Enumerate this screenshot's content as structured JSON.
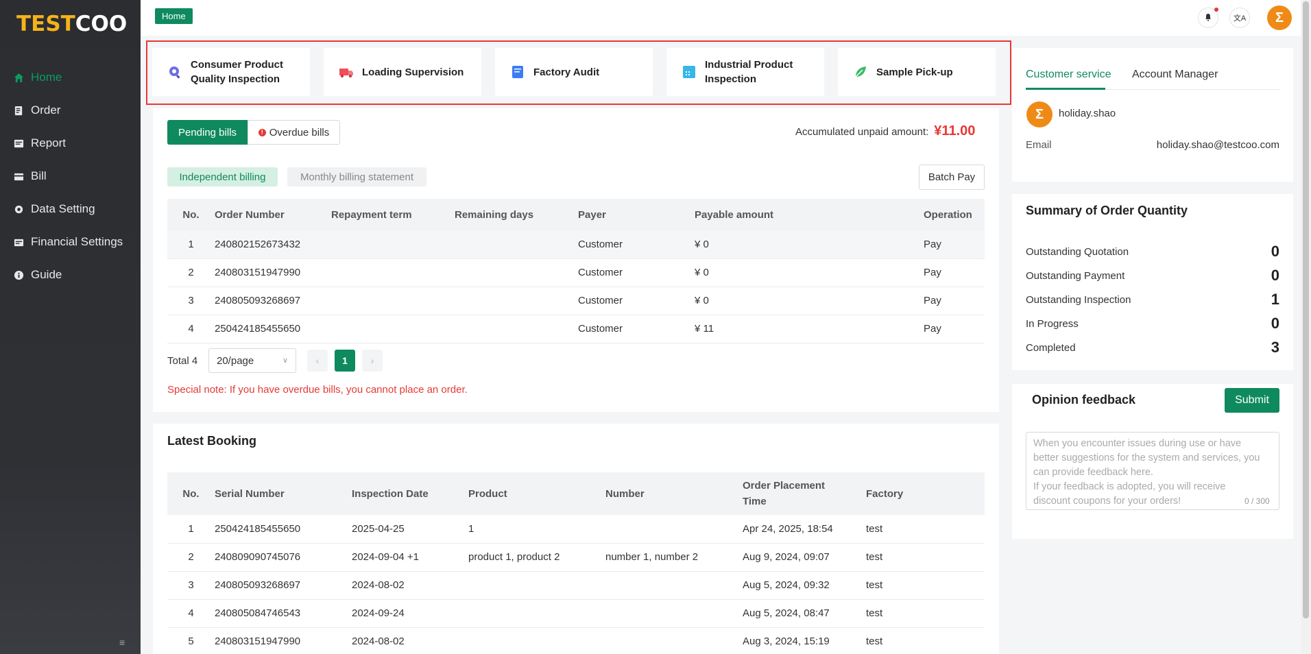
{
  "logo": {
    "part1": "TEST",
    "part2": "COO"
  },
  "sidebar": {
    "items": [
      {
        "label": "Home",
        "icon": "home-icon",
        "active": true
      },
      {
        "label": "Order",
        "icon": "order-icon"
      },
      {
        "label": "Report",
        "icon": "report-icon"
      },
      {
        "label": "Bill",
        "icon": "bill-icon"
      },
      {
        "label": "Data Setting",
        "icon": "gear-icon"
      },
      {
        "label": "Financial Settings",
        "icon": "financial-icon"
      },
      {
        "label": "Guide",
        "icon": "info-icon"
      }
    ],
    "toggle": "≡"
  },
  "header": {
    "breadcrumb": "Home",
    "translate_glyph": "文A"
  },
  "services": [
    {
      "line1": "Consumer Product",
      "line2": "Quality Inspection",
      "icon": "consumer-inspection-icon"
    },
    {
      "line1": "Loading Supervision",
      "line2": "",
      "icon": "truck-icon"
    },
    {
      "line1": "Factory Audit",
      "line2": "",
      "icon": "document-icon"
    },
    {
      "line1": "Industrial Product",
      "line2": "Inspection",
      "icon": "industrial-icon"
    },
    {
      "line1": "Sample Pick-up",
      "line2": "",
      "icon": "leaf-icon"
    }
  ],
  "bills": {
    "pending_label": "Pending bills",
    "overdue_label": "Overdue bills",
    "accum_label": "Accumulated unpaid amount:",
    "accum_value": "¥11.00",
    "independent_label": "Independent billing",
    "monthly_label": "Monthly billing statement",
    "batch_pay_label": "Batch Pay",
    "columns": [
      "No.",
      "Order Number",
      "Repayment term",
      "Remaining days",
      "Payer",
      "Payable amount",
      "Operation"
    ],
    "rows": [
      {
        "no": "1",
        "order": "240802152673432",
        "term": "",
        "days": "",
        "payer": "Customer",
        "amount": "¥ 0",
        "op": "Pay"
      },
      {
        "no": "2",
        "order": "240803151947990",
        "term": "",
        "days": "",
        "payer": "Customer",
        "amount": "¥ 0",
        "op": "Pay"
      },
      {
        "no": "3",
        "order": "240805093268697",
        "term": "",
        "days": "",
        "payer": "Customer",
        "amount": "¥ 0",
        "op": "Pay"
      },
      {
        "no": "4",
        "order": "250424185455650",
        "term": "",
        "days": "",
        "payer": "Customer",
        "amount": "¥ 11",
        "op": "Pay"
      }
    ],
    "total_label": "Total 4",
    "page_size": "20/page",
    "current_page": "1",
    "prev": "‹",
    "next": "›",
    "note": "Special note: If you have overdue bills, you cannot place an order."
  },
  "booking": {
    "title": "Latest Booking",
    "columns": [
      "No.",
      "Serial Number",
      "Inspection Date",
      "Product",
      "Number",
      "Order Placement Time",
      "Factory"
    ],
    "col_order_time_l1": "Order Placement",
    "col_order_time_l2": "Time",
    "rows": [
      {
        "no": "1",
        "serial": "250424185455650",
        "date": "2025-04-25",
        "product": "1",
        "number": "",
        "time": "Apr 24, 2025, 18:54",
        "factory": "test"
      },
      {
        "no": "2",
        "serial": "240809090745076",
        "date": "2024-09-04 +1",
        "product": "product 1, product 2",
        "number": "number 1, number 2",
        "time": "Aug 9, 2024, 09:07",
        "factory": "test"
      },
      {
        "no": "3",
        "serial": "240805093268697",
        "date": "2024-08-02",
        "product": "",
        "number": "",
        "time": "Aug 5, 2024, 09:32",
        "factory": "test"
      },
      {
        "no": "4",
        "serial": "240805084746543",
        "date": "2024-09-24",
        "product": "",
        "number": "",
        "time": "Aug 5, 2024, 08:47",
        "factory": "test"
      },
      {
        "no": "5",
        "serial": "240803151947990",
        "date": "2024-08-02",
        "product": "",
        "number": "",
        "time": "Aug 3, 2024, 15:19",
        "factory": "test"
      }
    ]
  },
  "contact": {
    "tab_customer": "Customer service",
    "tab_manager": "Account Manager",
    "name": "holiday.shao",
    "email_label": "Email",
    "email_value": "holiday.shao@testcoo.com"
  },
  "summary": {
    "title": "Summary of Order Quantity",
    "rows": [
      {
        "label": "Outstanding Quotation",
        "value": "0"
      },
      {
        "label": "Outstanding Payment",
        "value": "0"
      },
      {
        "label": "Outstanding Inspection",
        "value": "1"
      },
      {
        "label": "In Progress",
        "value": "0"
      },
      {
        "label": "Completed",
        "value": "3"
      }
    ]
  },
  "feedback": {
    "title": "Opinion feedback",
    "submit_label": "Submit",
    "placeholder_l1": "When you encounter issues during use or have",
    "placeholder_l2": "better suggestions for the system and services, you",
    "placeholder_l3": "can provide feedback here.",
    "placeholder_l4": "If your feedback is adopted, you will receive",
    "placeholder_l5": "discount coupons for your orders!",
    "count": "0 / 300"
  },
  "colors": {
    "accent": "#0f8a5f",
    "danger": "#e53935",
    "brand": "#f5b31b",
    "sidebar": "#2b2d31"
  }
}
